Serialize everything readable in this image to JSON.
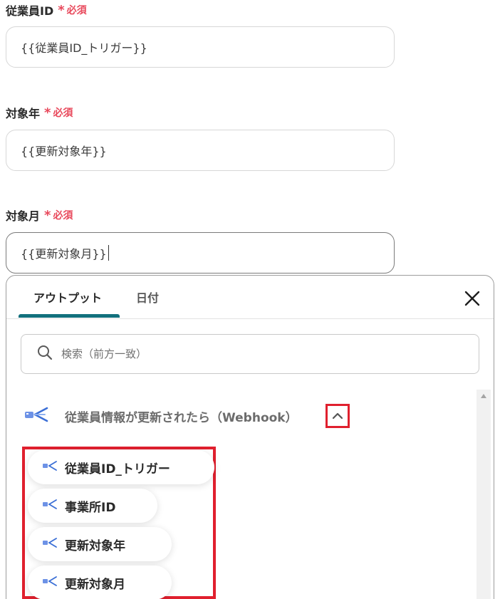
{
  "fields": [
    {
      "label": "従業員ID",
      "required_mark": "*",
      "required_text": "必須",
      "value": "{{従業員ID_トリガー}}"
    },
    {
      "label": "対象年",
      "required_mark": "*",
      "required_text": "必須",
      "value": "{{更新対象年}}"
    },
    {
      "label": "対象月",
      "required_mark": "*",
      "required_text": "必須",
      "value": "{{更新対象月}}"
    }
  ],
  "panel": {
    "tabs": [
      {
        "label": "アウトプット",
        "selected": true
      },
      {
        "label": "日付",
        "selected": false
      }
    ],
    "close_icon": "close-icon",
    "search": {
      "placeholder": "検索（前方一致）",
      "value": ""
    },
    "source": {
      "title": "従業員情報が更新されたら（Webhook）",
      "icon": "webhook-icon",
      "expanded": true
    },
    "items": [
      {
        "label": "従業員ID_トリガー"
      },
      {
        "label": "事業所ID"
      },
      {
        "label": "更新対象年"
      },
      {
        "label": "更新対象月"
      }
    ]
  },
  "colors": {
    "required": "#e8485b",
    "tab_accent": "#12707d",
    "highlight": "#e0202e",
    "webhook_icon": "#3b6fd6"
  }
}
